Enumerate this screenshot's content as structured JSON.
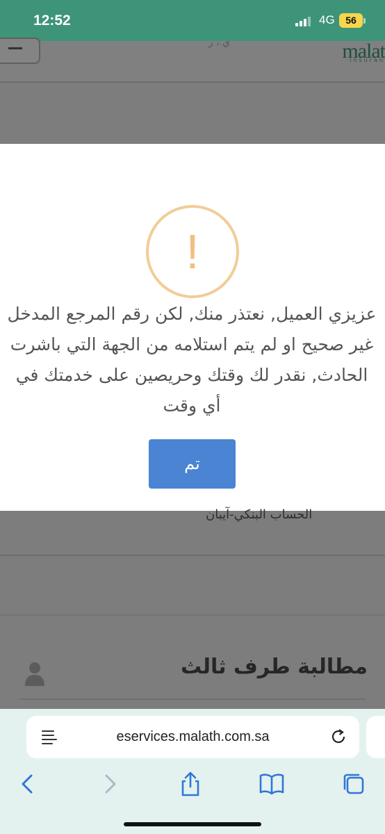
{
  "status_bar": {
    "time": "12:52",
    "network": "4G",
    "battery": "56"
  },
  "page": {
    "logo_text": "malat",
    "logo_sub": "insuran",
    "bank_account_text": "الحساب البنكي-آيبان",
    "section_title": "مطالبة طرف ثالث"
  },
  "modal": {
    "message": "عزيزي العميل, نعتذر منك, لكن رقم المرجع المدخل غير صحيح او لم يتم استلامه من الجهة التي باشرت الحادث, نقدر لك وقتك وحريصين على خدمتك في أي وقت",
    "warning_symbol": "!",
    "ok_label": "تم",
    "icon": "warning-icon",
    "accent_color": "#4a84d2",
    "warning_color": "#f1cd96"
  },
  "browser": {
    "url": "eservices.malath.com.sa",
    "icons": [
      "reader-icon",
      "reload-icon",
      "back-icon",
      "forward-icon",
      "share-icon",
      "bookmarks-icon",
      "tabs-icon"
    ]
  }
}
